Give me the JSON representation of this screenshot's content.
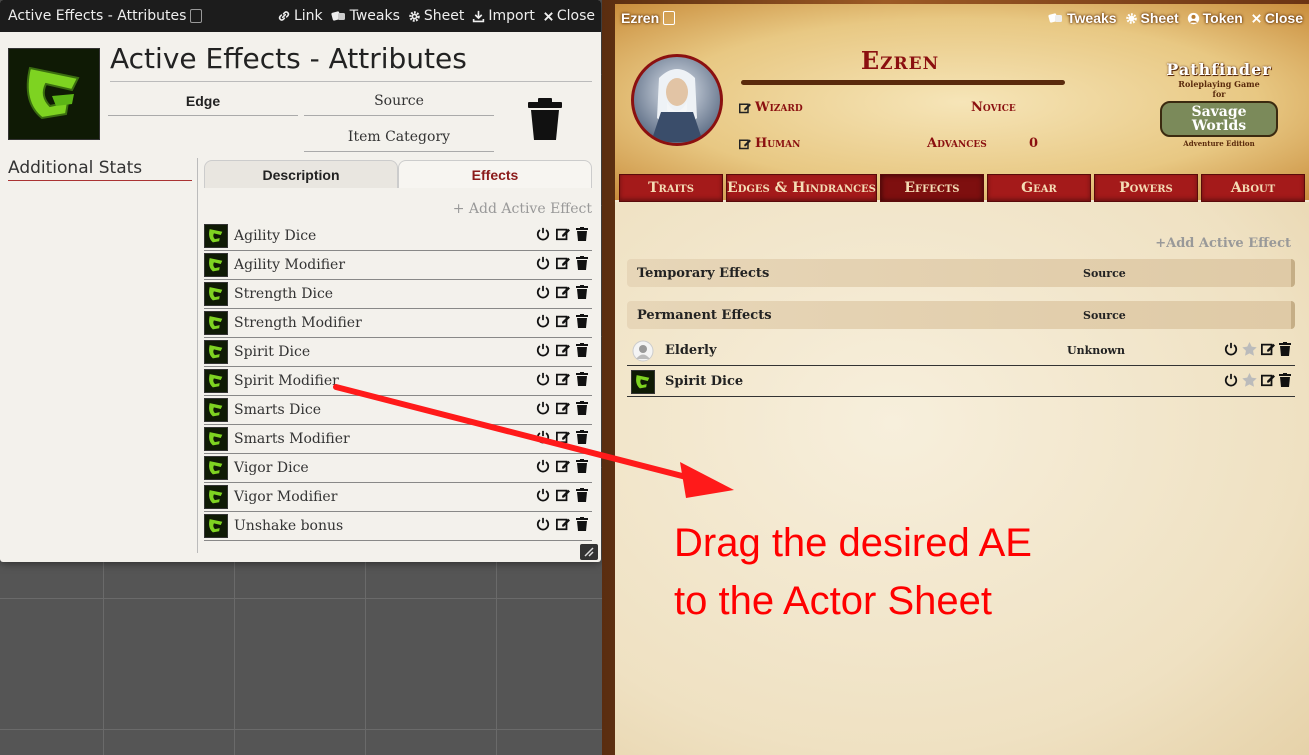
{
  "left_window": {
    "title": "Active Effects - Attributes",
    "header_buttons": [
      {
        "label": "Link",
        "icon": "link-icon"
      },
      {
        "label": "Tweaks",
        "icon": "dice-icon"
      },
      {
        "label": "Sheet",
        "icon": "gear-icon"
      },
      {
        "label": "Import",
        "icon": "import-icon"
      },
      {
        "label": "Close",
        "icon": "close-icon"
      }
    ],
    "item_name": "Active Effects - Attributes",
    "item_type": "Edge",
    "source_placeholder": "Source",
    "category_placeholder": "Item Category",
    "additional_stats": "Additional Stats",
    "tabs": [
      "Description",
      "Effects"
    ],
    "active_tab": "Effects",
    "add_active_effect": "+ Add Active Effect",
    "effects": [
      "Agility Dice",
      "Agility Modifier",
      "Strength Dice",
      "Strength Modifier",
      "Spirit Dice",
      "Spirit Modifier",
      "Smarts Dice",
      "Smarts Modifier",
      "Vigor Dice",
      "Vigor Modifier",
      "Unshake bonus"
    ]
  },
  "right_window": {
    "title": "Ezren",
    "header_buttons": [
      {
        "label": "Tweaks",
        "icon": "dice-icon"
      },
      {
        "label": "Sheet",
        "icon": "gear-icon"
      },
      {
        "label": "Token",
        "icon": "user-circle-icon"
      },
      {
        "label": "Close",
        "icon": "close-icon"
      }
    ],
    "actor_name": "Ezren",
    "archetype": "Wizard",
    "rank": "Novice",
    "race": "Human",
    "advances_label": "Advances",
    "advances_value": "0",
    "logo": {
      "line1": "Pathfinder",
      "line2": "Roleplaying Game",
      "line3": "for",
      "line4": "Savage Worlds",
      "line5": "Adventure Edition"
    },
    "tabs": [
      "Traits",
      "Edges & Hindrances",
      "Effects",
      "Gear",
      "Powers",
      "About"
    ],
    "active_tab": "Effects",
    "add_active_effect": "+Add Active Effect",
    "temporary_header": "Temporary Effects",
    "permanent_header": "Permanent Effects",
    "source_label": "Source",
    "permanent_effects": [
      {
        "name": "Elderly",
        "source": "Unknown"
      },
      {
        "name": "Spirit Dice",
        "source": ""
      }
    ]
  },
  "annotation": {
    "line1": "Drag the desired AE",
    "line2": "to the Actor Sheet",
    "color": "#ff0000"
  },
  "colors": {
    "sheet_red": "#a41a1a",
    "effects_tab_active": "#8b1a1a",
    "effect_icon_green": "#7ed321"
  }
}
